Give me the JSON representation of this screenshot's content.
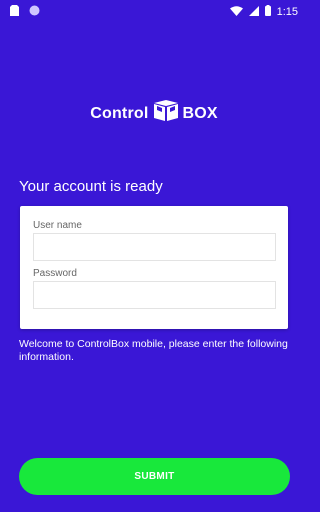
{
  "status_bar": {
    "time": "1:15",
    "left_icons": [
      "sim-card-icon",
      "record-circle-icon"
    ],
    "right_icons": [
      "wifi-icon",
      "signal-icon",
      "battery-icon"
    ]
  },
  "logo": {
    "word_left": "Control",
    "word_right": "BOX",
    "icon": "box-logo-icon"
  },
  "account_title": "Your account is ready",
  "form": {
    "username_label": "User name",
    "username_value": "",
    "password_label": "Password",
    "password_value": ""
  },
  "welcome_text": "Welcome to ControlBox mobile, please enter the following information.",
  "submit_label": "SUBMIT",
  "colors": {
    "background": "#3a17d6",
    "button": "#18e83b",
    "card": "#ffffff"
  }
}
